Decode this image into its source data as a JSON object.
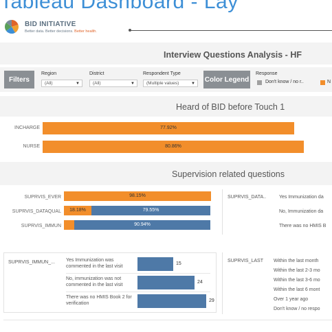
{
  "header": {
    "dashboard_title": "Tableau Dashboard - Lay",
    "brand": "BID INITIATIVE",
    "tagline_prefix": "Better data. Better decisions.",
    "tagline_accent": "Better health."
  },
  "page": {
    "title": "Interview Questions Analysis - HF"
  },
  "filters": {
    "chip_label": "Filters",
    "region": {
      "label": "Region",
      "value": "(All)"
    },
    "district": {
      "label": "District",
      "value": "(All)"
    },
    "respondent_type": {
      "label": "Respondent Type",
      "value": "(Multiple values)"
    }
  },
  "legend": {
    "chip_label": "Color Legend",
    "title": "Response",
    "items": [
      {
        "label": "Don't know / no r..",
        "color": "#a0a0a0"
      },
      {
        "label": "N",
        "color": "#f28e2b"
      }
    ]
  },
  "colors": {
    "orange": "#f28e2b",
    "blue": "#4e79a7",
    "grey": "#a0a0a0",
    "title_blue": "#3d8fd6"
  },
  "heard": {
    "title": "Heard of BID before Touch 1",
    "rows": [
      {
        "label": "INCHARGE",
        "value_label": "77.92%",
        "fraction": 0.7792
      },
      {
        "label": "NURSE",
        "value_label": "80.86%",
        "fraction": 0.8086
      }
    ]
  },
  "supervision": {
    "title": "Supervision related questions",
    "stacked_rows": [
      {
        "label": "SUPRVIS_EVER",
        "segments": [
          {
            "label": "98.15%",
            "fraction": 0.9815,
            "color": "orange"
          }
        ]
      },
      {
        "label": "SUPRVIS_DATAQUAL",
        "segments": [
          {
            "label": "18.18%",
            "fraction": 0.1818,
            "color": "orange"
          },
          {
            "label": "79.55%",
            "fraction": 0.7955,
            "color": "blue"
          }
        ]
      },
      {
        "label": "SUPRVIS_IMMUN",
        "segments": [
          {
            "label": "",
            "fraction": 0.0706,
            "color": "orange"
          },
          {
            "label": "90.94%",
            "fraction": 0.9094,
            "color": "blue"
          }
        ]
      }
    ],
    "dataqual_panel": {
      "label": "SUPRVIS_DATA..",
      "options": [
        "Yes Immunization da",
        "No, Immunization da",
        "There was no HMIS B"
      ]
    },
    "immun_panel": {
      "label": "SUPRVIS_IMMUN_...",
      "max": 29,
      "rows": [
        {
          "label": "Yes Immunization was commented in the last visit",
          "value": 15
        },
        {
          "label": "No, immunization was not commented in the last visit",
          "value": 24
        },
        {
          "label": "There was no HMIS Book 2 for verification",
          "value": 29
        }
      ]
    },
    "last_panel": {
      "label": "SUPRVIS_LAST",
      "options": [
        "Within the last month",
        "Within the last 2-3 mo",
        "Within the last 3-6 mo",
        "Within the last 6 mont",
        "Over 1 year ago",
        "Don't know / no respo"
      ]
    }
  }
}
